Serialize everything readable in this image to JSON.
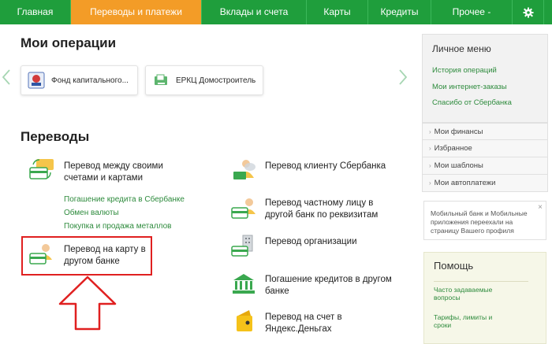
{
  "nav": {
    "items": [
      "Главная",
      "Переводы и платежи",
      "Вклады и счета",
      "Карты",
      "Кредиты",
      "Прочее -"
    ],
    "active_index": 1
  },
  "operations": {
    "title": "Мои операции",
    "cards": [
      "Фонд капитального...",
      "ЕРКЦ Домостроитель"
    ]
  },
  "transfers": {
    "title": "Переводы",
    "left": [
      {
        "label": "Перевод между своими счетами и картами",
        "icon": "cards-exchange-icon"
      },
      {
        "label": "Перевод на карту в другом банке",
        "icon": "person-card-icon"
      }
    ],
    "sub_links": [
      "Погашение кредита в Сбербанке",
      "Обмен валюты",
      "Покупка и продажа металлов"
    ],
    "right": [
      {
        "label": "Перевод клиенту Сбербанка",
        "icon": "person-card-icon"
      },
      {
        "label": "Перевод частному лицу в другой банк по реквизитам",
        "icon": "person-card-icon"
      },
      {
        "label": "Перевод организации",
        "icon": "office-card-icon"
      },
      {
        "label": "Погашение кредитов в другом банке",
        "icon": "bank-icon"
      },
      {
        "label": "Перевод на счет в Яндекс.Деньгах",
        "icon": "yandex-wallet-icon"
      }
    ]
  },
  "sidebar": {
    "title": "Личное меню",
    "links": [
      "История операций",
      "Мои интернет-заказы",
      "Спасибо от Сбербанка"
    ],
    "rows": [
      "Мои финансы",
      "Избранное",
      "Мои шаблоны",
      "Мои автоплатежи"
    ],
    "promo_text": "Мобильный банк и Мобильные приложения переехали на страницу Вашего профиля",
    "help": {
      "title": "Помощь",
      "links": [
        "Часто задаваемые вопросы",
        "Тарифы, лимиты и сроки"
      ]
    }
  },
  "colors": {
    "nav_green": "#1f9e3c",
    "nav_active": "#f39c27",
    "link_green": "#2e8b3d",
    "highlight_red": "#e02020"
  }
}
